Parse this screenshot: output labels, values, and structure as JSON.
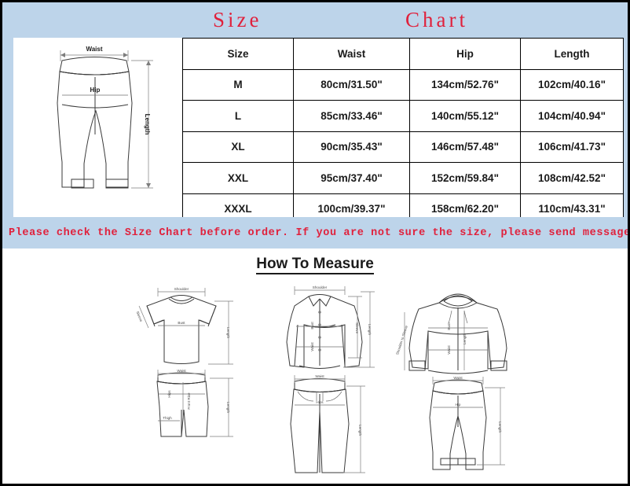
{
  "title": {
    "word1": "Size",
    "word2": "Chart"
  },
  "colors": {
    "band": "#bdd4ea",
    "accent_red": "#e0213c",
    "text": "#1b1b1b",
    "line": "#3a3a3a"
  },
  "pants_diagram": {
    "waist_label": "Waist",
    "hip_label": "Hip",
    "length_label": "Length"
  },
  "chart_data": {
    "type": "table",
    "title": "Size Chart",
    "columns": [
      "Size",
      "Waist",
      "Hip",
      "Length"
    ],
    "rows": [
      [
        "M",
        "80cm/31.50\"",
        "134cm/52.76\"",
        "102cm/40.16\""
      ],
      [
        "L",
        "85cm/33.46\"",
        "140cm/55.12\"",
        "104cm/40.94\""
      ],
      [
        "XL",
        "90cm/35.43\"",
        "146cm/57.48\"",
        "106cm/41.73\""
      ],
      [
        "XXL",
        "95cm/37.40\"",
        "152cm/59.84\"",
        "108cm/42.52\""
      ],
      [
        "XXXL",
        "100cm/39.37\"",
        "158cm/62.20\"",
        "110cm/43.31\""
      ]
    ]
  },
  "notice": "Please check the Size Chart before order. If you are not sure the size, please send message to us.",
  "how_to_measure": {
    "heading": "How To Measure",
    "groups": [
      {
        "name": "tshirt-and-shorts",
        "top": {
          "garment": "t-shirt",
          "labels": [
            "Shoulder",
            "Sleeve",
            "Bust",
            "Length"
          ]
        },
        "bottom": {
          "garment": "shorts",
          "labels": [
            "Waist",
            "Hips",
            "Front Rise",
            "Thigh",
            "Length"
          ]
        }
      },
      {
        "name": "shirt-and-pants",
        "top": {
          "garment": "long-sleeve-shirt",
          "labels": [
            "Shoulder",
            "Bust",
            "Waist",
            "Sleeve",
            "Length"
          ]
        },
        "bottom": {
          "garment": "pants",
          "labels": [
            "Waist",
            "Hips",
            "Length"
          ]
        }
      },
      {
        "name": "hoodie-and-joggers",
        "top": {
          "garment": "hoodie",
          "labels": [
            "Shoulder to Sleeve",
            "Bust",
            "Length",
            "Waist"
          ]
        },
        "bottom": {
          "garment": "joggers",
          "labels": [
            "Waist",
            "Hip",
            "Length"
          ]
        }
      }
    ]
  }
}
